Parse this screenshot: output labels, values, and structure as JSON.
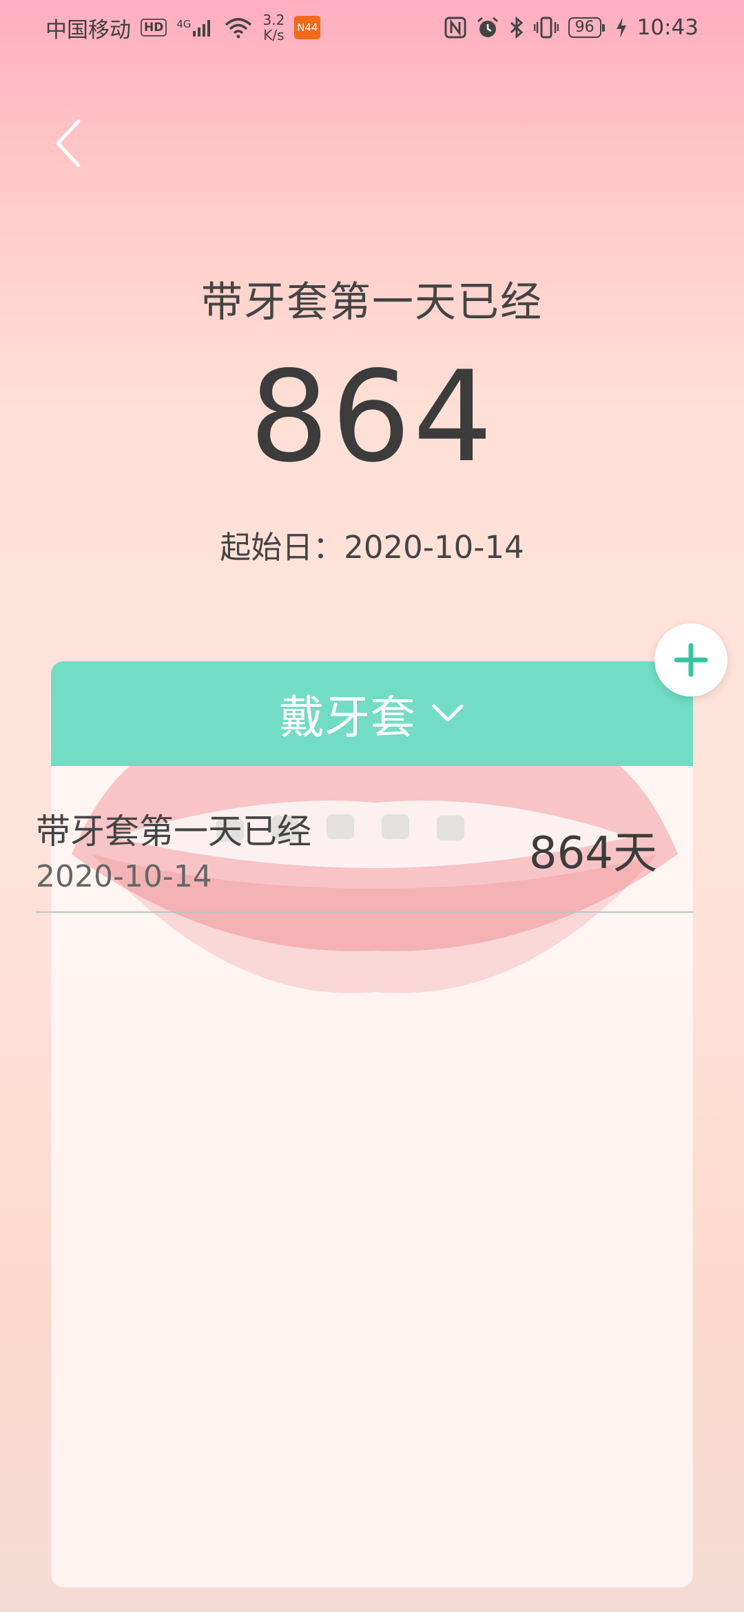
{
  "status_bar": {
    "carrier": "中国移动",
    "hd": "HD",
    "network": "4G",
    "speed_value": "3.2",
    "speed_unit": "K/s",
    "app_badge_text": "N44",
    "battery": "96",
    "time": "10:43",
    "icons": [
      "nfc-icon",
      "alarm-icon",
      "bluetooth-icon",
      "vibrate-icon",
      "charging-icon"
    ]
  },
  "hero": {
    "title": "带牙套第一天已经",
    "count": "864",
    "start_label": "起始日：",
    "start_date": "2020-10-14"
  },
  "card": {
    "header_label": "戴牙套",
    "accent_color": "#72dcc4",
    "rows": [
      {
        "title": "带牙套第一天已经",
        "date": "2020-10-14",
        "count": "864天"
      }
    ]
  }
}
